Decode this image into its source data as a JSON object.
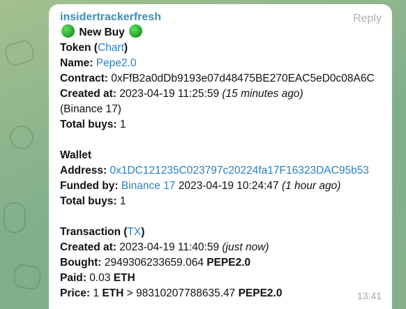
{
  "message": {
    "sender": "insidertrackerfresh",
    "reply_label": "Reply",
    "time": "13:41",
    "header": {
      "left_icon": "green-circle-emoji",
      "title": "New Buy",
      "right_icon": "green-circle-emoji"
    },
    "token": {
      "label": "Token",
      "open_paren": " (",
      "chart_link": "Chart",
      "close_paren": ")",
      "name_label": "Name:",
      "name_link": "Pepe2.0",
      "contract_label": "Contract:",
      "contract": "0xFfB2a0dDb9193e07d48475BE270EAC5eD0c08A6C",
      "created_label": "Created at:",
      "created": "2023-04-19 11:25:59",
      "created_rel": "(15 minutes ago)",
      "source": "(Binance 17)",
      "total_buys_label": "Total buys:",
      "total_buys": "1"
    },
    "wallet": {
      "label": "Wallet",
      "address_label": "Address:",
      "address": "0x1DC121235C023797c20224fa17F16323DAC95b53",
      "funded_label": "Funded by:",
      "funded_link": "Binance 17",
      "funded_time": "2023-04-19 10:24:47",
      "funded_rel": "(1 hour ago)",
      "total_buys_label": "Total buys:",
      "total_buys": "1"
    },
    "transaction": {
      "label": "Transaction",
      "open_paren": " (",
      "tx_link": "TX",
      "close_paren": ")",
      "created_label": "Created at:",
      "created": "2023-04-19 11:40:59",
      "created_rel": "(just now)",
      "bought_label": "Bought:",
      "bought_amount": "2949306233659.064",
      "bought_symbol": "PEPE2.0",
      "paid_label": "Paid:",
      "paid_amount": "0.03",
      "paid_symbol": "ETH",
      "price_label": "Price:",
      "price_one": "1",
      "price_eth": "ETH",
      "price_arrow": ">",
      "price_amount": "98310207788635.47",
      "price_symbol": "PEPE2.0"
    }
  }
}
